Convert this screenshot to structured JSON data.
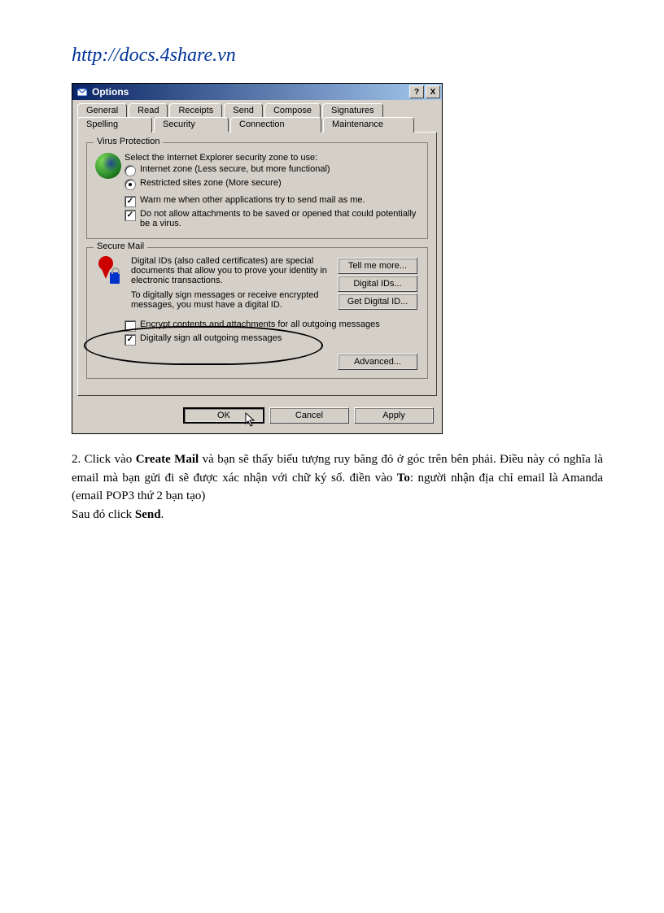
{
  "watermark": "http://docs.4share.vn",
  "dialog": {
    "title": "Options",
    "help": "?",
    "close": "X",
    "tabs_row1": [
      "General",
      "Read",
      "Receipts",
      "Send",
      "Compose",
      "Signatures"
    ],
    "tabs_row2": [
      "Spelling",
      "Security",
      "Connection",
      "Maintenance"
    ],
    "active_tab": "Security",
    "virus": {
      "title": "Virus Protection",
      "zone_label": "Select the Internet Explorer security zone to use:",
      "radio1": "Internet zone (Less secure, but more functional)",
      "radio2": "Restricted sites zone (More secure)",
      "chk1": "Warn me when other applications try to send mail as me.",
      "chk2": "Do not allow attachments to be saved or opened that could potentially be a virus."
    },
    "secure": {
      "title": "Secure Mail",
      "para1": "Digital IDs (also called certificates) are special documents that allow you to prove your identity in electronic transactions.",
      "para2": "To digitally sign messages or receive encrypted messages, you must have a digital ID.",
      "btn1": "Tell me more...",
      "btn2": "Digital IDs...",
      "btn3": "Get Digital ID...",
      "chk_encrypt": "Encrypt contents and attachments for all outgoing messages",
      "chk_sign": "Digitally sign all outgoing messages"
    },
    "advanced": "Advanced...",
    "ok": "OK",
    "cancel": "Cancel",
    "apply": "Apply"
  },
  "body": {
    "prefix": "2. Click vào ",
    "b1": "Create Mail",
    "mid1": " và bạn sẽ thấy biểu tượng ruy băng đỏ ở góc trên bên phải. Điều này có nghĩa là email mà bạn gửi đi sẽ được xác nhận với chữ ký số. điền vào ",
    "b2": "To",
    "mid2": ": người nhận địa chỉ email là Amanda (email POP3 thứ 2 bạn tạo)",
    "line2a": "Sau đó click ",
    "b3": "Send",
    "line2b": "."
  }
}
